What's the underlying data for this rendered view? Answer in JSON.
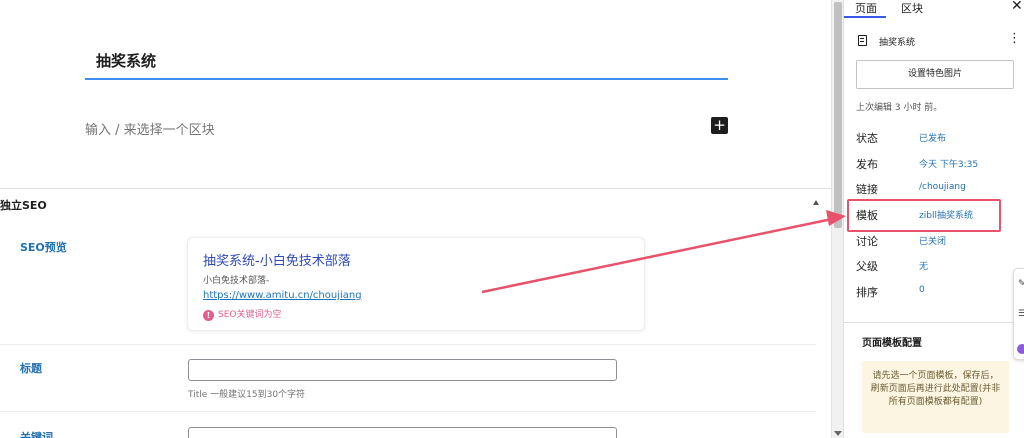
{
  "editor": {
    "post_title": "抽奖系统",
    "block_placeholder": "输入 / 来选择一个区块",
    "inserter_label": "+"
  },
  "seo_box": {
    "title": "独立SEO",
    "preview_label": "SEO预览",
    "preview": {
      "title": "抽奖系统-小白免技术部落",
      "description": "小白免技术部落-",
      "url": "https://www.amitu.cn/choujiang",
      "warning_icon": "!",
      "warning": "SEO关键词为空"
    },
    "title_field_label": "标题",
    "title_field_value": "",
    "title_help": "Title 一般建议15到30个字符",
    "keywords_field_label": "关键词"
  },
  "sidebar": {
    "tabs": [
      "页面",
      "区块"
    ],
    "active_tab": 0,
    "close_label": "✕",
    "doc_title": "抽奖系统",
    "more_label": "⋮",
    "featured_image_button": "设置特色图片",
    "last_edited": "上次编辑 3 小时 前。",
    "properties": [
      {
        "label": "状态",
        "value": "已发布"
      },
      {
        "label": "发布",
        "value": "今天 下午3:35"
      },
      {
        "label": "链接",
        "value": "/choujiang"
      },
      {
        "label": "模板",
        "value": "zibll抽奖系统"
      },
      {
        "label": "讨论",
        "value": "已关闭"
      },
      {
        "label": "父级",
        "value": "无"
      },
      {
        "label": "排序",
        "value": "0"
      }
    ],
    "template_panel": {
      "title": "页面模板配置",
      "notice": "请先选一个页面模板，保存后，刷新页面后再进行此处配置(并非所有页面模板都有配置)"
    }
  },
  "colors": {
    "accent": "#3858e9",
    "link": "#2271b1",
    "highlight": "#e8526a",
    "warning": "#e35d8f",
    "notice_bg": "#fcf5e1"
  }
}
